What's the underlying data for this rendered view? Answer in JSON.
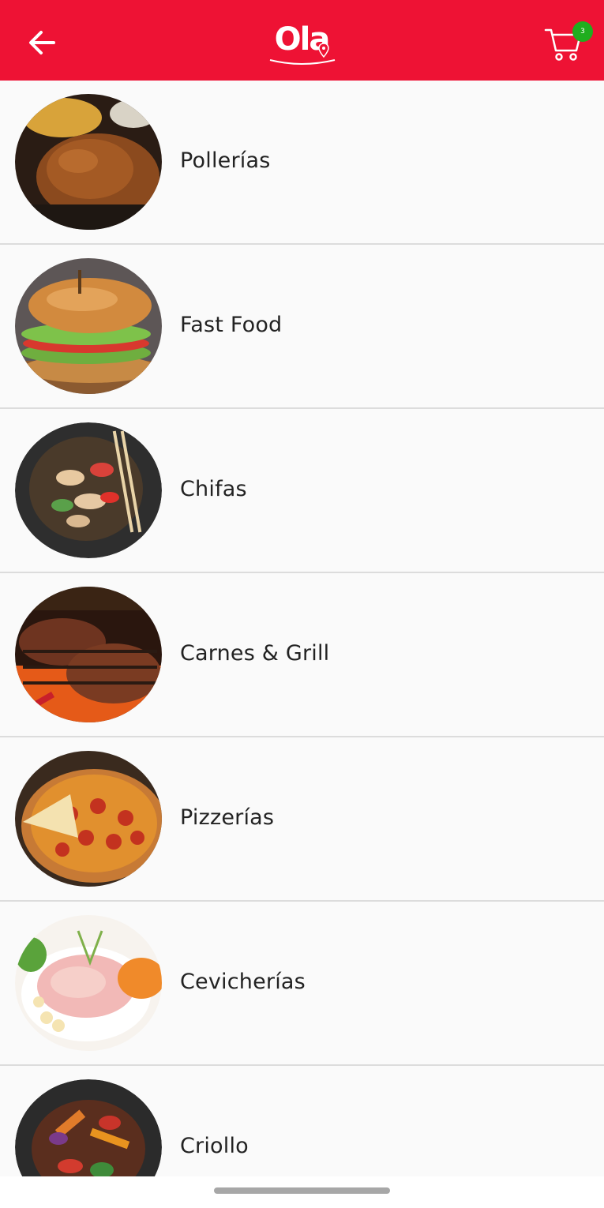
{
  "header": {
    "brand": "Ola",
    "back_icon": "arrow-left-icon",
    "cart_icon": "shopping-cart-icon",
    "cart_count": "3",
    "background_color": "#ee1234",
    "badge_color": "#1fae1f"
  },
  "categories": [
    {
      "label": "Pollerías",
      "image": "roast-chicken-image"
    },
    {
      "label": "Fast Food",
      "image": "burger-image"
    },
    {
      "label": "Chifas",
      "image": "stir-fry-image"
    },
    {
      "label": "Carnes & Grill",
      "image": "grilled-steak-image"
    },
    {
      "label": "Pizzerías",
      "image": "pepperoni-pizza-image"
    },
    {
      "label": "Cevicherías",
      "image": "ceviche-image"
    },
    {
      "label": "Criollo",
      "image": "lomo-saltado-image"
    }
  ]
}
